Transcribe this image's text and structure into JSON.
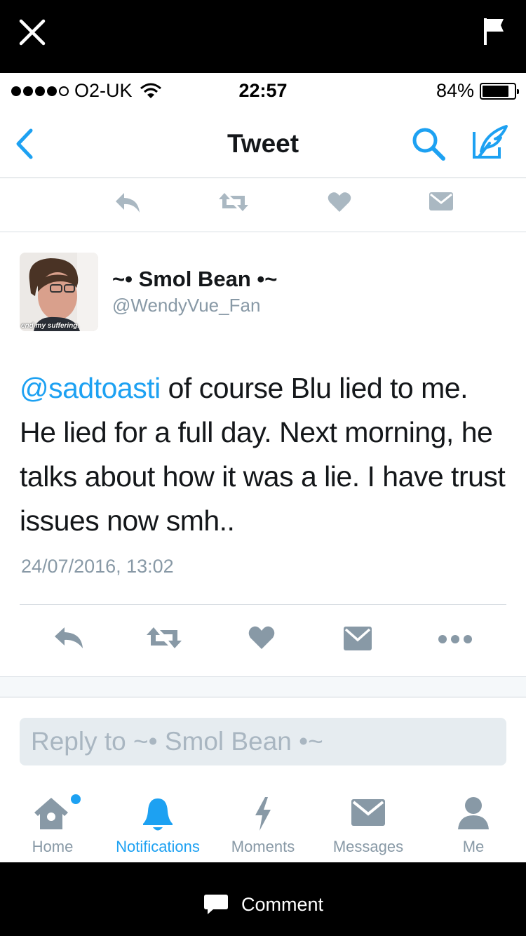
{
  "overlay": {
    "close_icon": "close-icon",
    "flag_icon": "flag-icon",
    "comment_label": "Comment"
  },
  "status_bar": {
    "signal_dots_filled": 4,
    "signal_dots_total": 5,
    "carrier": "O2-UK",
    "time": "22:57",
    "battery_percent": "84%",
    "battery_level": 0.84
  },
  "nav": {
    "title": "Tweet"
  },
  "tweet": {
    "display_name": "~• Smol Bean •~",
    "handle": "@WendyVue_Fan",
    "avatar_caption": "end my suffering.",
    "mention": "@sadtoasti",
    "body": " of course Blu lied to me. He lied for a full day. Next morning, he talks about how it was a lie. I have trust issues now smh..",
    "timestamp": "24/07/2016, 13:02"
  },
  "reply": {
    "placeholder": "Reply to ~• Smol Bean •~"
  },
  "tabs": [
    {
      "label": "Home",
      "icon": "home-icon",
      "active": false,
      "has_dot": true
    },
    {
      "label": "Notifications",
      "icon": "bell-icon",
      "active": true
    },
    {
      "label": "Moments",
      "icon": "lightning-icon",
      "active": false
    },
    {
      "label": "Messages",
      "icon": "envelope-icon",
      "active": false
    },
    {
      "label": "Me",
      "icon": "person-icon",
      "active": false
    }
  ],
  "colors": {
    "accent": "#1da1f2",
    "icon_gray": "#aab8c2",
    "text": "#14171a",
    "muted": "#8899a6"
  }
}
